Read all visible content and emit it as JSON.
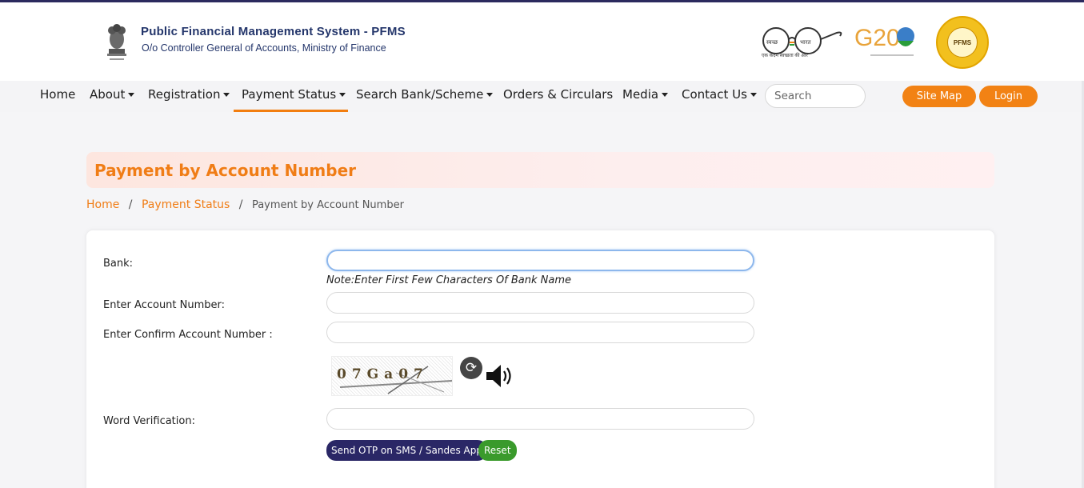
{
  "header": {
    "title": "Public Financial Management System - PFMS",
    "subtitle": "O/o Controller General of Accounts, Ministry of Finance",
    "swachh_caption": "एक कदम स्वच्छता की ओर",
    "swachh_left": "स्वच्छ",
    "swachh_right": "भारत",
    "g20_text": "G20",
    "pfms_logo_text": "PFMS"
  },
  "nav": {
    "items": [
      {
        "label": "Home"
      },
      {
        "label": "About"
      },
      {
        "label": "Registration"
      },
      {
        "label": "Payment Status"
      },
      {
        "label": "Search Bank/Scheme"
      },
      {
        "label": "Orders & Circulars"
      },
      {
        "label": "Media"
      },
      {
        "label": "Contact Us"
      }
    ],
    "search_placeholder": "Search",
    "site_map_label": "Site Map",
    "login_label": "Login",
    "accent": "#f27e10"
  },
  "page": {
    "title": "Payment by Account Number",
    "breadcrumb": {
      "home": "Home",
      "section": "Payment Status",
      "current": "Payment by Account Number"
    }
  },
  "form": {
    "bank_label": "Bank:",
    "bank_value": "",
    "bank_note": "Note:Enter First Few Characters Of Bank Name",
    "account_label": "Enter Account Number:",
    "account_value": "",
    "confirm_label": "Enter Confirm Account Number :",
    "confirm_value": "",
    "captcha_text": "07Ga07",
    "word_label": "Word Verification:",
    "word_value": "",
    "otp_button": "Send OTP on SMS / Sandes App",
    "reset_button": "Reset"
  }
}
